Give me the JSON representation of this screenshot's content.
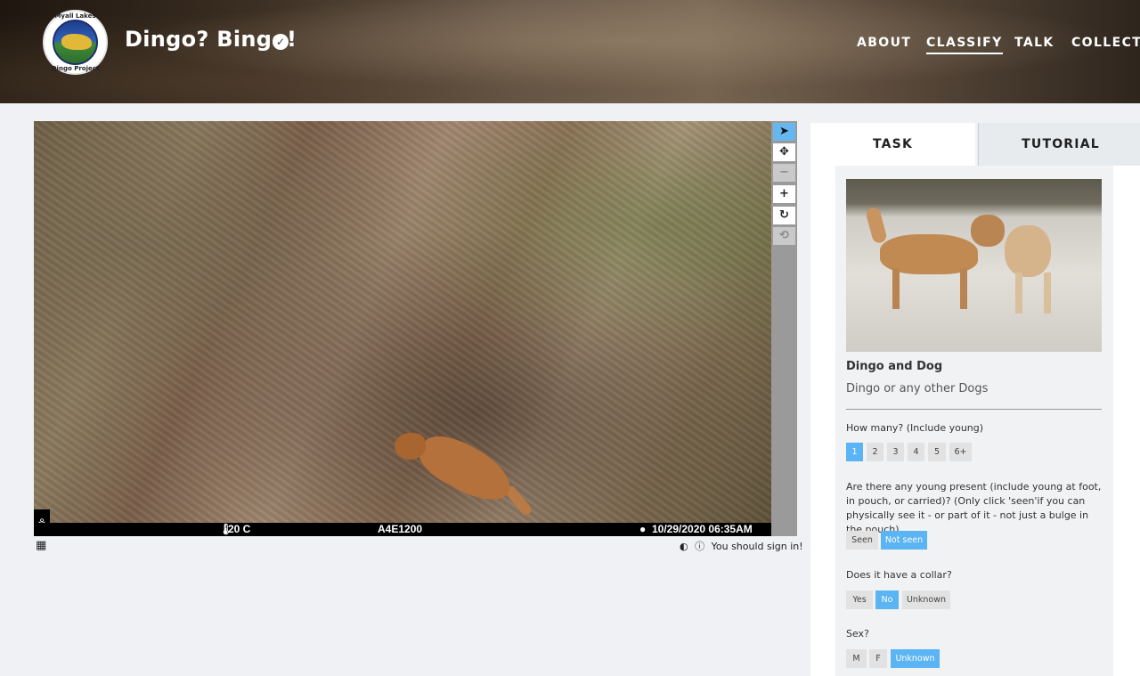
{
  "header": {
    "logo_text_top": "Myall Lakes",
    "logo_text_bottom": "Dingo Project",
    "project_title": "Dingo? Bingo!",
    "verified_icon": "checkmark-icon",
    "nav": [
      "ABOUT",
      "CLASSIFY",
      "TALK",
      "COLLECT"
    ],
    "active_nav": "CLASSIFY"
  },
  "viewer": {
    "temperature": "20 C",
    "camera_id": "A4E1200",
    "timestamp": "10/29/2020 06:35AM",
    "toolbar": [
      "pointer-icon",
      "move-icon",
      "zoom-out-icon",
      "zoom-in-icon",
      "rotate-icon",
      "reset-icon"
    ],
    "sign_in_message": "You should sign in!"
  },
  "panel": {
    "tabs": [
      "TASK",
      "TUTORIAL"
    ],
    "example_title": "Dingo and Dog",
    "example_subtitle": "Dingo or any other Dogs",
    "q1": {
      "text": "How many? (Include young)",
      "options": [
        "1",
        "2",
        "3",
        "4",
        "5",
        "6+"
      ],
      "selected": "1"
    },
    "q2": {
      "text": "Are there any young present (include young at foot, in pouch, or carried)? (Only click 'seen'if you can physically see it - or part of it - not just a bulge in the pouch)",
      "options": [
        "Seen",
        "Not seen"
      ],
      "selected": "Not seen"
    },
    "q3": {
      "text": "Does it have a collar?",
      "options": [
        "Yes",
        "No",
        "Unknown"
      ],
      "selected": "No"
    },
    "q4": {
      "text": "Sex?",
      "options": [
        "M",
        "F",
        "Unknown"
      ],
      "selected": "Unknown"
    }
  },
  "colors": {
    "accent": "#5bb4f3",
    "toolbar": "#9a9a9a"
  }
}
